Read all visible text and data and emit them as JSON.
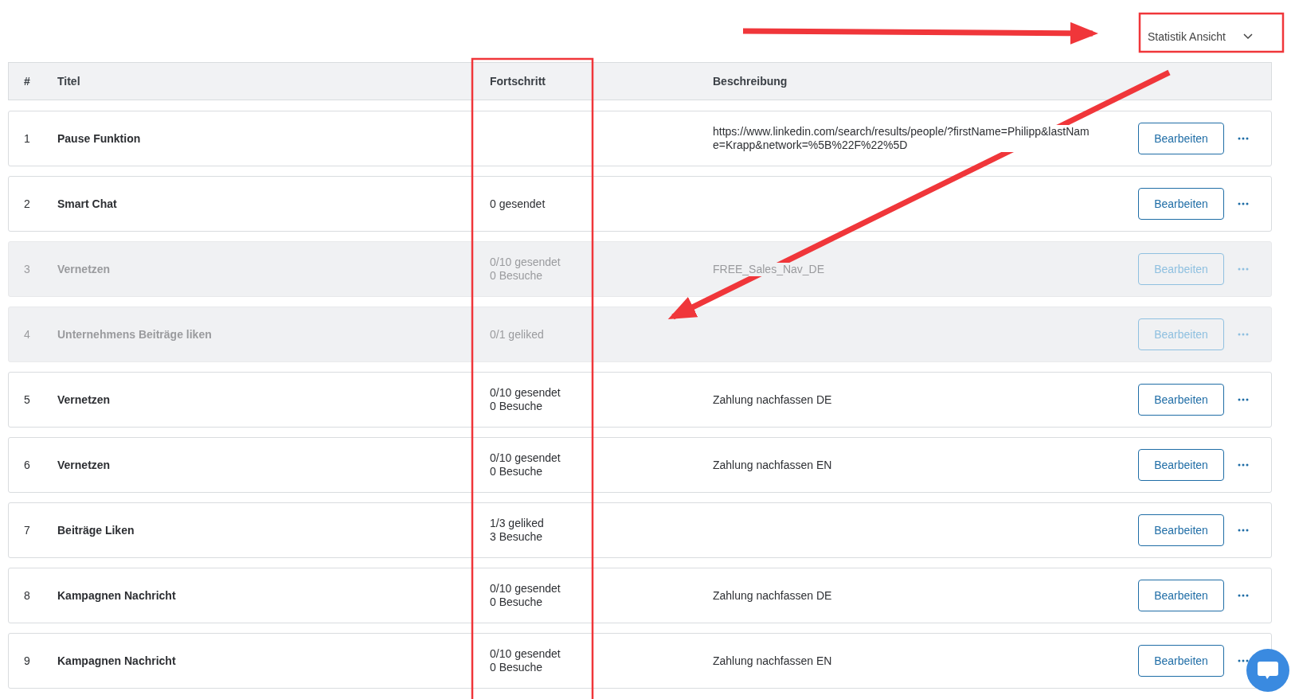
{
  "view_select": {
    "label": "Statistik Ansicht"
  },
  "table": {
    "columns": [
      "#",
      "Titel",
      "Fortschritt",
      "Beschreibung"
    ],
    "rows": [
      {
        "number": "1",
        "title": "Pause Funktion",
        "progress": [],
        "description": "https://www.linkedin.com/search/results/people/?firstName=Philipp&lastName=Krapp&network=%5B%22F%22%5D",
        "disabled": false,
        "action": "Bearbeiten"
      },
      {
        "number": "2",
        "title": "Smart Chat",
        "progress": [
          "0 gesendet"
        ],
        "description": "",
        "disabled": false,
        "action": "Bearbeiten"
      },
      {
        "number": "3",
        "title": "Vernetzen",
        "progress": [
          "0/10 gesendet",
          "0 Besuche"
        ],
        "description": "FREE_Sales_Nav_DE",
        "disabled": true,
        "action": "Bearbeiten"
      },
      {
        "number": "4",
        "title": "Unternehmens Beiträge liken",
        "progress": [
          "0/1 geliked"
        ],
        "description": "",
        "disabled": true,
        "action": "Bearbeiten"
      },
      {
        "number": "5",
        "title": "Vernetzen",
        "progress": [
          "0/10 gesendet",
          "0 Besuche"
        ],
        "description": "Zahlung nachfassen DE",
        "disabled": false,
        "action": "Bearbeiten"
      },
      {
        "number": "6",
        "title": "Vernetzen",
        "progress": [
          "0/10 gesendet",
          "0 Besuche"
        ],
        "description": "Zahlung nachfassen EN",
        "disabled": false,
        "action": "Bearbeiten"
      },
      {
        "number": "7",
        "title": "Beiträge Liken",
        "progress": [
          "1/3 geliked",
          "3 Besuche"
        ],
        "description": "",
        "disabled": false,
        "action": "Bearbeiten"
      },
      {
        "number": "8",
        "title": "Kampagnen Nachricht",
        "progress": [
          "0/10 gesendet",
          "0 Besuche"
        ],
        "description": "Zahlung nachfassen DE",
        "disabled": false,
        "action": "Bearbeiten"
      },
      {
        "number": "9",
        "title": "Kampagnen Nachricht",
        "progress": [
          "0/10 gesendet",
          "0 Besuche"
        ],
        "description": "Zahlung nachfassen EN",
        "disabled": false,
        "action": "Bearbeiten"
      }
    ]
  }
}
